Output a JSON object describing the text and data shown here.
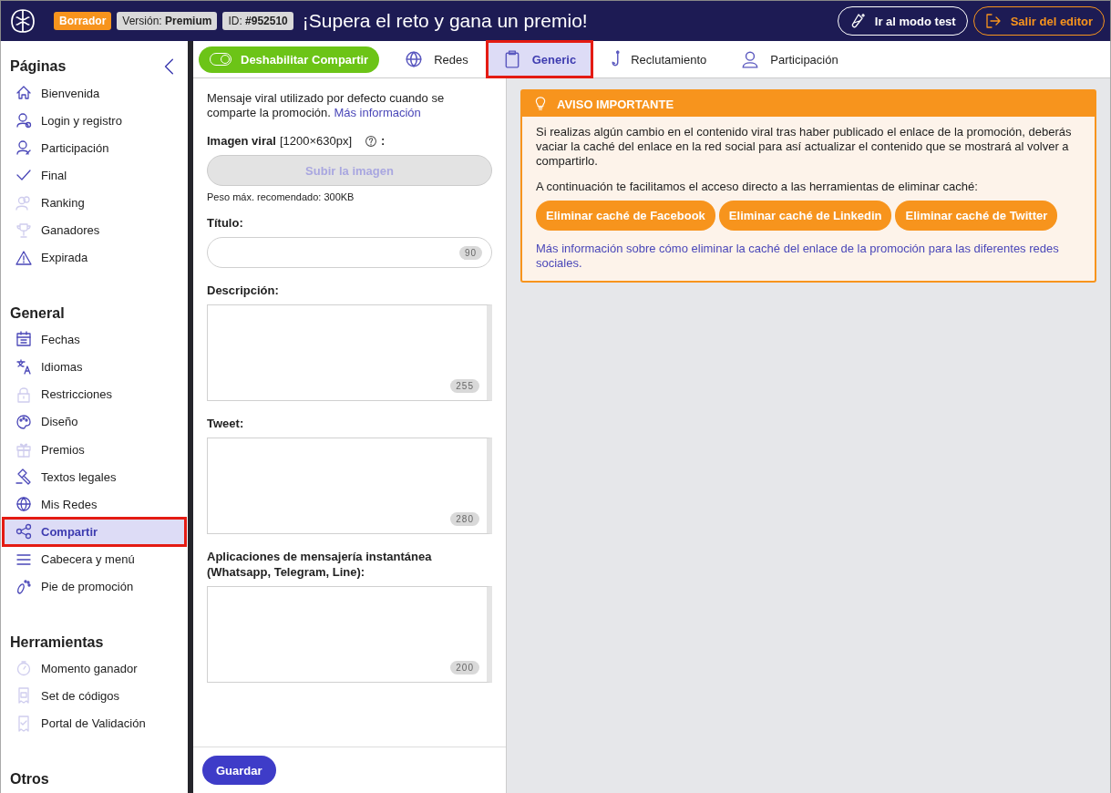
{
  "header": {
    "status_badge": "Borrador",
    "version_label": "Versión:",
    "version_value": "Premium",
    "id_label": "ID:",
    "id_value": "#952510",
    "title": "¡Supera el reto y gana un premio!",
    "buttons": [
      {
        "kind": "test",
        "label": "Ir al modo test"
      },
      {
        "kind": "exit",
        "label": "Salir del editor"
      }
    ]
  },
  "sidebar": {
    "sections": [
      {
        "title": "Páginas",
        "items": [
          {
            "label": "Bienvenida",
            "kind": "house",
            "dimmed": false,
            "selected": false,
            "highlighted": false
          },
          {
            "label": "Login y registro",
            "kind": "user-gear",
            "dimmed": false,
            "selected": false,
            "highlighted": false
          },
          {
            "label": "Participación",
            "kind": "user-edit",
            "dimmed": false,
            "selected": false,
            "highlighted": false
          },
          {
            "label": "Final",
            "kind": "check",
            "dimmed": false,
            "selected": false,
            "highlighted": false
          },
          {
            "label": "Ranking",
            "kind": "users",
            "dimmed": true,
            "selected": false,
            "highlighted": false
          },
          {
            "label": "Ganadores",
            "kind": "trophy",
            "dimmed": true,
            "selected": false,
            "highlighted": false
          },
          {
            "label": "Expirada",
            "kind": "warning",
            "dimmed": false,
            "selected": false,
            "highlighted": false
          }
        ]
      },
      {
        "title": "General",
        "items": [
          {
            "label": "Fechas",
            "kind": "calendar",
            "dimmed": false,
            "selected": false,
            "highlighted": false
          },
          {
            "label": "Idiomas",
            "kind": "translate",
            "dimmed": false,
            "selected": false,
            "highlighted": false
          },
          {
            "label": "Restricciones",
            "kind": "lock",
            "dimmed": true,
            "selected": false,
            "highlighted": false
          },
          {
            "label": "Diseño",
            "kind": "palette",
            "dimmed": false,
            "selected": false,
            "highlighted": false
          },
          {
            "label": "Premios",
            "kind": "gift",
            "dimmed": true,
            "selected": false,
            "highlighted": false
          },
          {
            "label": "Textos legales",
            "kind": "gavel",
            "dimmed": false,
            "selected": false,
            "highlighted": false
          },
          {
            "label": "Mis Redes",
            "kind": "globe",
            "dimmed": false,
            "selected": false,
            "highlighted": false
          },
          {
            "label": "Compartir",
            "kind": "share",
            "dimmed": false,
            "selected": true,
            "highlighted": true
          },
          {
            "label": "Cabecera y menú",
            "kind": "menu",
            "dimmed": false,
            "selected": false,
            "highlighted": false
          },
          {
            "label": "Pie de promoción",
            "kind": "foot",
            "dimmed": false,
            "selected": false,
            "highlighted": false
          }
        ]
      },
      {
        "title": "Herramientas",
        "items": [
          {
            "label": "Momento ganador",
            "kind": "stopwatch",
            "dimmed": true,
            "selected": false,
            "highlighted": false
          },
          {
            "label": "Set de códigos",
            "kind": "ticket",
            "dimmed": true,
            "selected": false,
            "highlighted": false
          },
          {
            "label": "Portal de Validación",
            "kind": "ticket-check",
            "dimmed": true,
            "selected": false,
            "highlighted": false
          }
        ]
      },
      {
        "title": "Otros"
      }
    ]
  },
  "toolbar": {
    "toggle": {
      "label": "Deshabilitar Compartir",
      "on": true
    },
    "tabs": [
      {
        "label": "Redes",
        "kind": "globe",
        "selected": false,
        "highlighted": false
      },
      {
        "label": "Generic",
        "kind": "clipboard",
        "selected": true,
        "highlighted": true
      },
      {
        "label": "Reclutamiento",
        "kind": "hook",
        "selected": false,
        "highlighted": false
      },
      {
        "label": "Participación",
        "kind": "user",
        "selected": false,
        "highlighted": false
      }
    ]
  },
  "form": {
    "intro": "Mensaje viral utilizado por defecto cuando se comparte la promoción.",
    "intro_link": "Más información",
    "image_label": "Imagen viral",
    "image_size": "[1200×630px]",
    "image_colon": ":",
    "upload_button": "Subir la imagen",
    "upload_note": "Peso máx. recomendado: 300KB",
    "fields": [
      {
        "kind": "input",
        "label": "Título:",
        "counter": "90"
      },
      {
        "kind": "textarea",
        "label": "Descripción:",
        "counter": "255"
      },
      {
        "kind": "textarea",
        "label": "Tweet:",
        "counter": "280"
      },
      {
        "kind": "textarea",
        "label": "Aplicaciones de mensajería instantánea (Whatsapp, Telegram, Line):",
        "counter": "200"
      }
    ],
    "save_button": "Guardar"
  },
  "notice": {
    "title": "AVISO IMPORTANTE",
    "paragraphs": [
      "Si realizas algún cambio en el contenido viral tras haber publicado el enlace de la promoción, deberás vaciar la caché del enlace en la red social para así actualizar el contenido que se mostrará al volver a compartirlo.",
      "A continuación te facilitamos el acceso directo a las herramientas de eliminar caché:"
    ],
    "buttons": [
      "Eliminar caché de Facebook",
      "Eliminar caché de Linkedin",
      "Eliminar caché de Twitter"
    ],
    "link": "Más información sobre cómo eliminar la caché del enlace de la promoción para las diferentes redes sociales."
  }
}
